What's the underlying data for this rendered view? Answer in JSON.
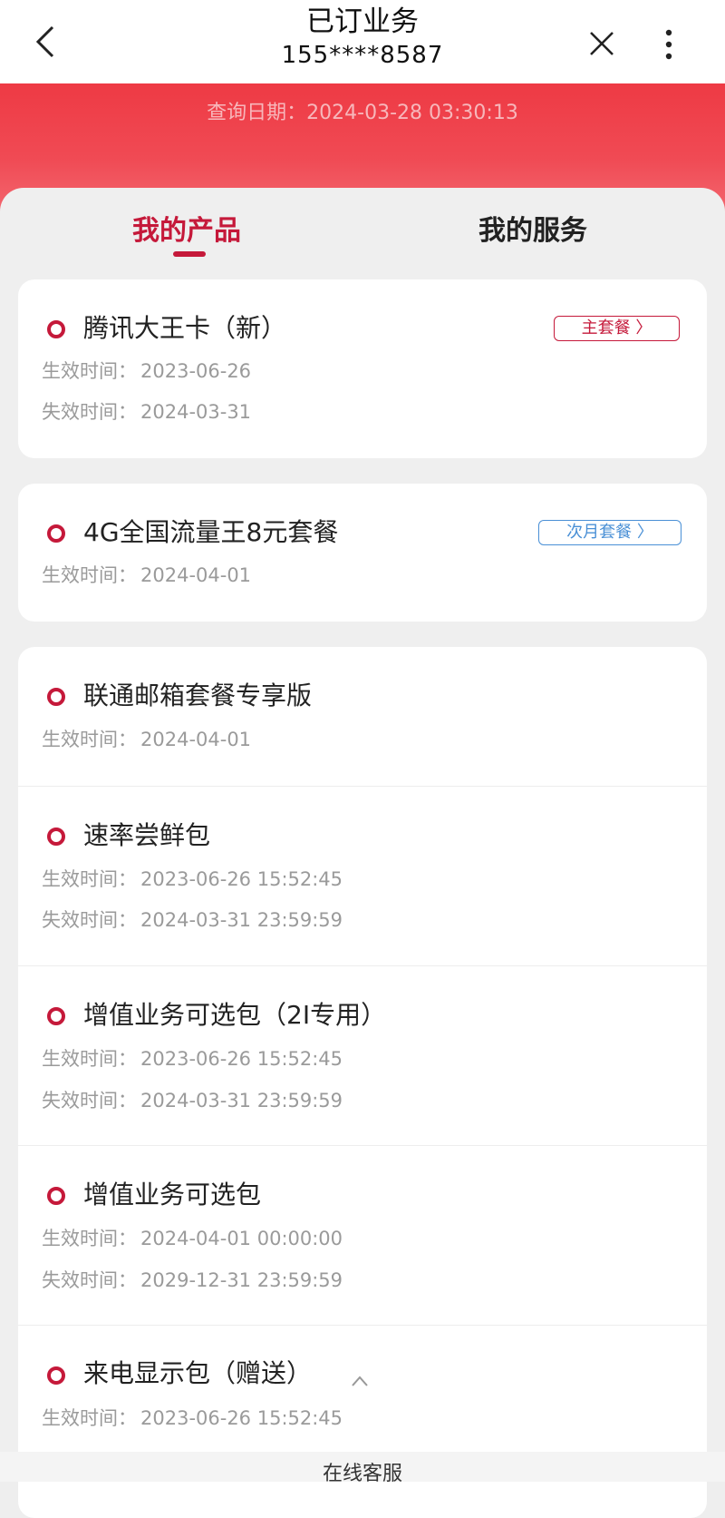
{
  "header": {
    "title": "已订业务",
    "phone": "155****8587"
  },
  "banner": {
    "query_label": "查询日期：",
    "query_date": "2024-03-28 03:30:13"
  },
  "tabs": [
    {
      "label": "我的产品",
      "active": true
    },
    {
      "label": "我的服务",
      "active": false
    }
  ],
  "labels": {
    "effective": "生效时间：",
    "expire": "失效时间："
  },
  "products": [
    {
      "name": "腾讯大王卡（新）",
      "badge": "主套餐 〉",
      "badge_style": "red",
      "effective": "2023-06-26",
      "expire": "2024-03-31"
    },
    {
      "name": "4G全国流量王8元套餐",
      "badge": "次月套餐 〉",
      "badge_style": "blue",
      "effective": "2024-04-01"
    },
    {
      "name": "联通邮箱套餐专享版",
      "effective": "2024-04-01"
    },
    {
      "name": "速率尝鲜包",
      "effective": "2023-06-26 15:52:45",
      "expire": "2024-03-31 23:59:59"
    },
    {
      "name": "增值业务可选包（2I专用）",
      "effective": "2023-06-26 15:52:45",
      "expire": "2024-03-31 23:59:59"
    },
    {
      "name": "增值业务可选包",
      "effective": "2024-04-01 00:00:00",
      "expire": "2029-12-31 23:59:59"
    },
    {
      "name": "来电显示包（赠送）",
      "effective": "2023-06-26 15:52:45"
    }
  ],
  "footer": {
    "label": "在线客服"
  },
  "colors": {
    "accent": "#c5193a",
    "banner": "#ee3a44",
    "next_month": "#4a90d6"
  },
  "icons": [
    "back-icon",
    "close-icon",
    "more-icon",
    "chevron-up-icon"
  ]
}
